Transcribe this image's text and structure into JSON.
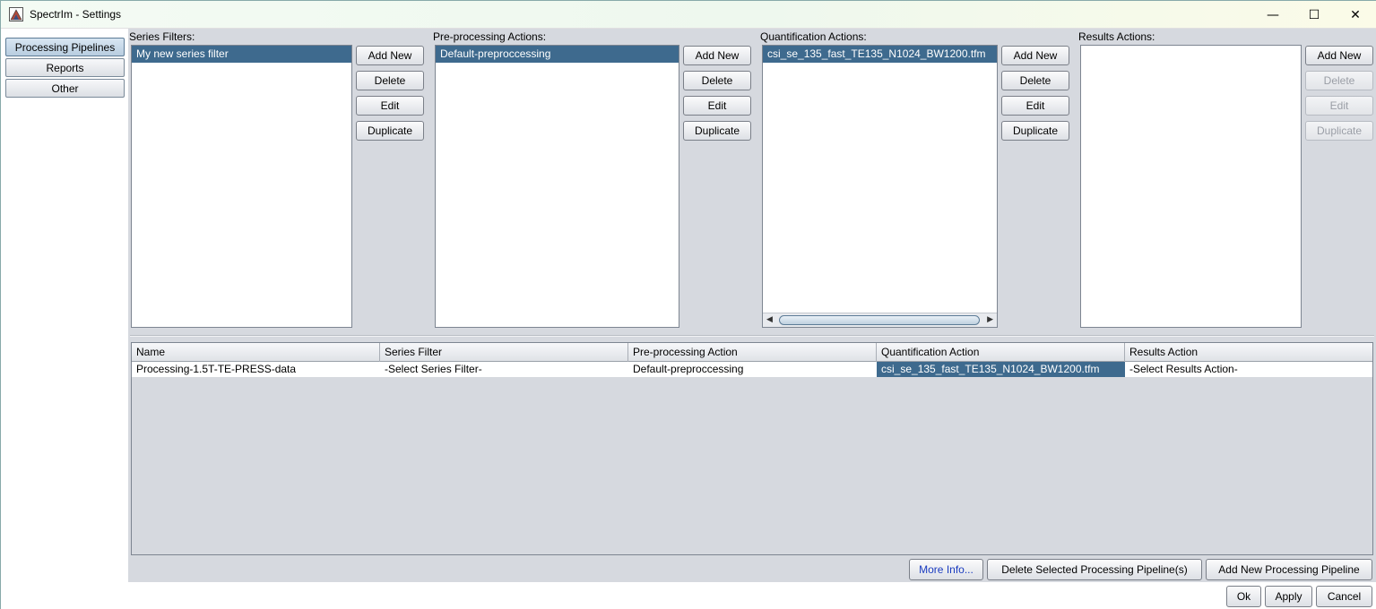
{
  "window": {
    "title": "SpectrIm - Settings",
    "minimize_symbol": "—",
    "maximize_symbol": "☐",
    "close_symbol": "✕"
  },
  "nav": {
    "items": [
      {
        "label": "Processing Pipelines",
        "active": true
      },
      {
        "label": "Reports",
        "active": false
      },
      {
        "label": "Other",
        "active": false
      }
    ]
  },
  "panels": {
    "series_filters": {
      "label": "Series Filters:",
      "items": [
        "My new series filter"
      ],
      "buttons": [
        "Add New",
        "Delete",
        "Edit",
        "Duplicate"
      ]
    },
    "preprocessing": {
      "label": "Pre-processing Actions:",
      "items": [
        "Default-preproccessing"
      ],
      "buttons": [
        "Add New",
        "Delete",
        "Edit",
        "Duplicate"
      ]
    },
    "quantification": {
      "label": "Quantification Actions:",
      "items": [
        "csi_se_135_fast_TE135_N1024_BW1200.tfm"
      ],
      "buttons": [
        "Add New",
        "Delete",
        "Edit",
        "Duplicate"
      ]
    },
    "results": {
      "label": "Results Actions:",
      "items": [],
      "buttons": [
        "Add New",
        "Delete",
        "Edit",
        "Duplicate"
      ]
    }
  },
  "pipelines_table": {
    "columns": [
      "Name",
      "Series Filter",
      "Pre-processing Action",
      "Quantification Action",
      "Results Action"
    ],
    "rows": [
      [
        "Processing-1.5T-TE-PRESS-data",
        "-Select Series Filter-",
        "Default-preproccessing",
        "csi_se_135_fast_TE135_N1024_BW1200.tfm",
        "-Select Results Action-"
      ]
    ]
  },
  "actions": {
    "more_info": "More Info...",
    "delete_pipeline": "Delete Selected Processing Pipeline(s)",
    "add_pipeline": "Add New Processing Pipeline"
  },
  "footer": {
    "ok": "Ok",
    "apply": "Apply",
    "cancel": "Cancel"
  }
}
